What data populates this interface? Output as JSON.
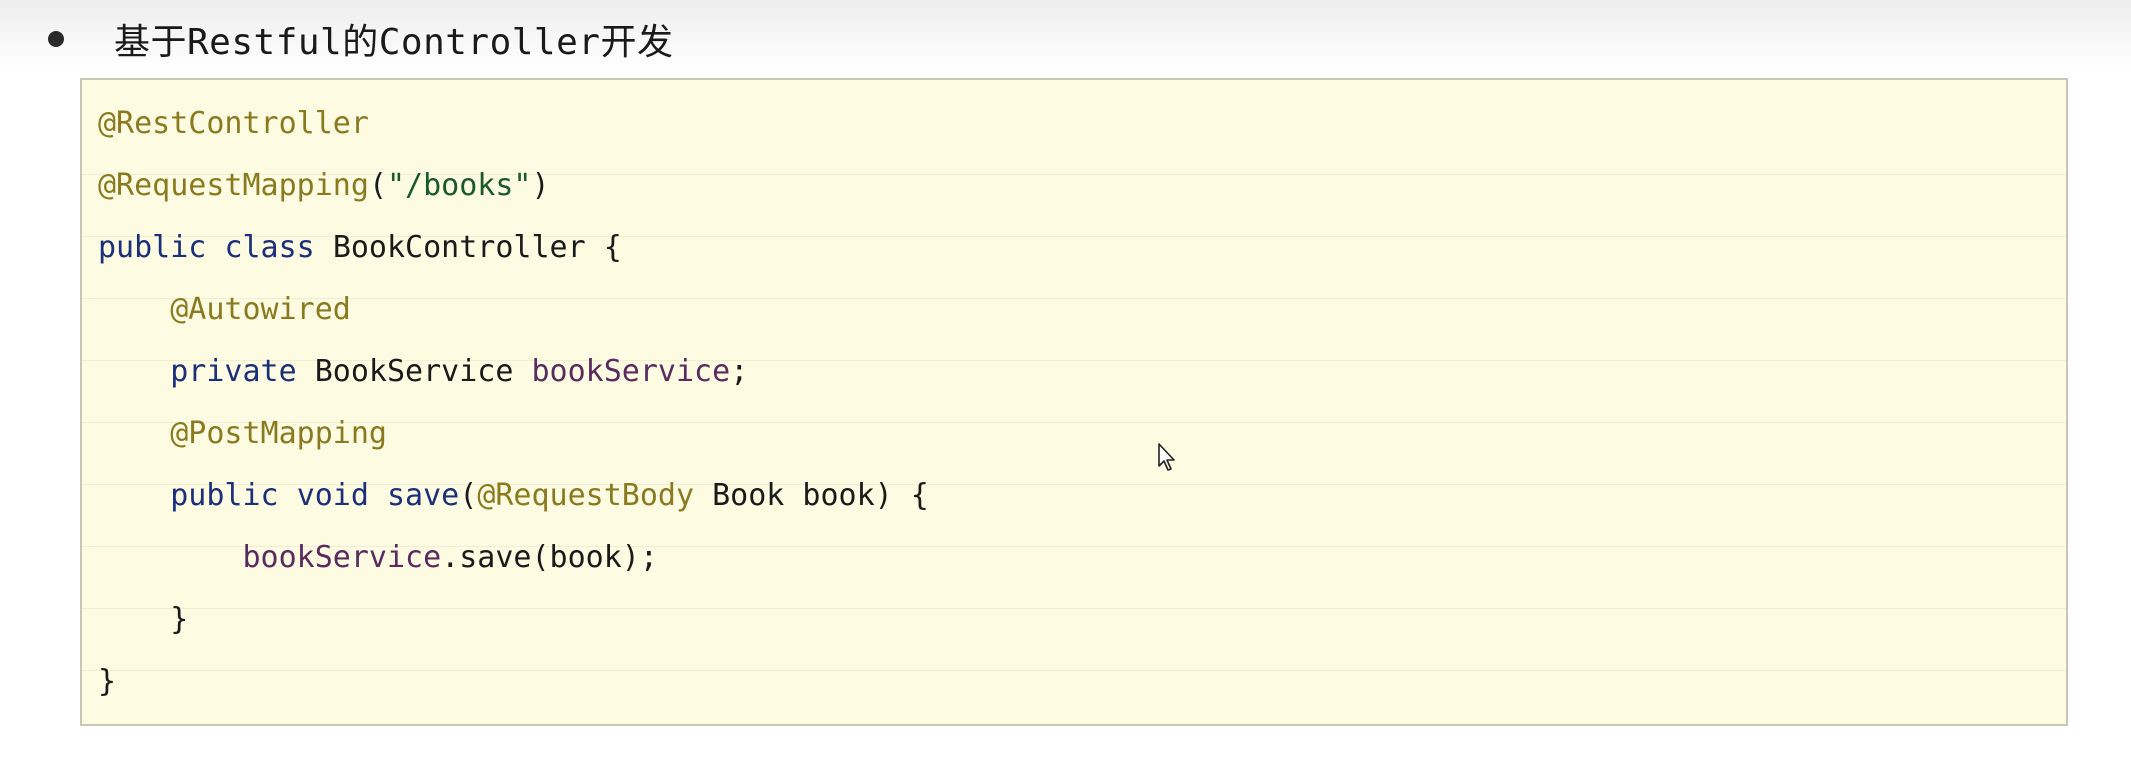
{
  "heading": {
    "text": "基于Restful的Controller开发"
  },
  "code": {
    "l1": {
      "ann": "@RestController"
    },
    "l2": {
      "ann": "@RequestMapping",
      "open": "(",
      "str": "\"/books\"",
      "close": ")"
    },
    "l3": {
      "kw1": "public",
      "kw2": "class",
      "name": "BookController",
      "brace": "{"
    },
    "l4": {
      "indent": "    ",
      "ann": "@Autowired"
    },
    "l5": {
      "indent": "    ",
      "kw": "private",
      "type": "BookService",
      "field": "bookService",
      "semi": ";"
    },
    "l6": {
      "indent": "    ",
      "ann": "@PostMapping"
    },
    "l7": {
      "indent": "    ",
      "kw1": "public",
      "kw2": "void",
      "method": "save",
      "open": "(",
      "ann": "@RequestBody",
      "rest": "Book book) {"
    },
    "l8": {
      "indent": "        ",
      "field": "bookService",
      "call": ".save(book);"
    },
    "l9": {
      "indent": "    ",
      "brace": "}"
    },
    "l10": {
      "brace": "}"
    }
  },
  "colors": {
    "annotation": "#8a7a1f",
    "string": "#1a5a2a",
    "keyword": "#1b2f7a",
    "field": "#5b2a5e",
    "background": "#fdfce3"
  }
}
